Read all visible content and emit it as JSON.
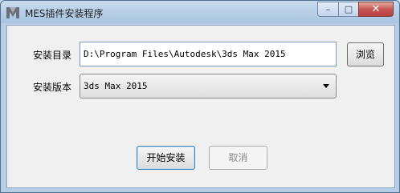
{
  "window": {
    "title": "MES插件安装程序",
    "controls": {
      "minimize": "–",
      "maximize": "□",
      "close": "✕"
    }
  },
  "form": {
    "install_dir_label": "安装目录",
    "install_dir_value": "D:\\Program Files\\Autodesk\\3ds Max 2015",
    "browse_label": "浏览",
    "version_label": "安装版本",
    "version_value": "3ds Max 2015"
  },
  "actions": {
    "start_label": "开始安装",
    "cancel_label": "取消"
  },
  "colors": {
    "accent": "#3c7fb1",
    "close_button": "#c75050"
  }
}
